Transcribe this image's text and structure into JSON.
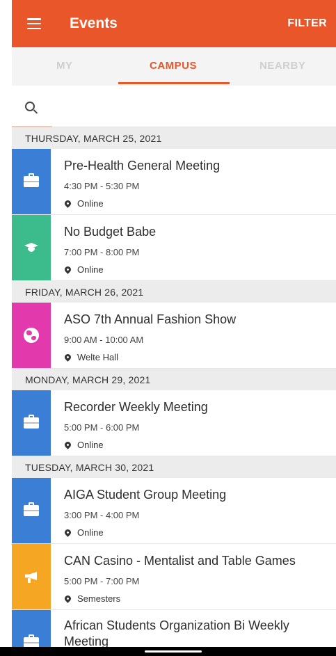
{
  "appbar": {
    "title": "Events",
    "filter_label": "FILTER",
    "menu_icon": "hamburger-menu-icon",
    "color": "#e8562a"
  },
  "tabs": [
    {
      "label": "MY",
      "active": false
    },
    {
      "label": "CAMPUS",
      "active": true
    },
    {
      "label": "NEARBY",
      "active": false
    }
  ],
  "search": {
    "icon": "search-icon",
    "value": "",
    "placeholder": ""
  },
  "sections": [
    {
      "date": "THURSDAY, MARCH 25, 2021",
      "events": [
        {
          "name": "Pre-Health General Meeting",
          "time": "4:30 PM - 5:30 PM",
          "location": "Online",
          "icon": "briefcase-icon",
          "color": "#3a7fd5"
        },
        {
          "name": "No Budget Babe",
          "time": "7:00 PM - 8:00 PM",
          "location": "Online",
          "icon": "graduation-cap-icon",
          "color": "#3cbc8d"
        }
      ]
    },
    {
      "date": "FRIDAY, MARCH 26, 2021",
      "events": [
        {
          "name": "ASO 7th Annual Fashion Show",
          "time": "9:00 AM - 10:00 AM",
          "location": "Welte Hall",
          "icon": "globe-icon",
          "color": "#e23aad"
        }
      ]
    },
    {
      "date": "MONDAY, MARCH 29, 2021",
      "events": [
        {
          "name": "Recorder Weekly Meeting",
          "time": "5:00 PM - 6:00 PM",
          "location": "Online",
          "icon": "briefcase-icon",
          "color": "#3a7fd5"
        }
      ]
    },
    {
      "date": "TUESDAY, MARCH 30, 2021",
      "events": [
        {
          "name": "AIGA Student Group Meeting",
          "time": "3:00 PM - 4:00 PM",
          "location": "Online",
          "icon": "briefcase-icon",
          "color": "#3a7fd5"
        },
        {
          "name": "CAN Casino - Mentalist and Table Games",
          "time": "5:00 PM - 7:00 PM",
          "location": "Semesters",
          "icon": "megaphone-icon",
          "color": "#f5a623"
        },
        {
          "name": "African Students Organization Bi Weekly Meeting",
          "time": "",
          "location": "",
          "icon": "briefcase-icon",
          "color": "#3a7fd5"
        }
      ]
    }
  ]
}
